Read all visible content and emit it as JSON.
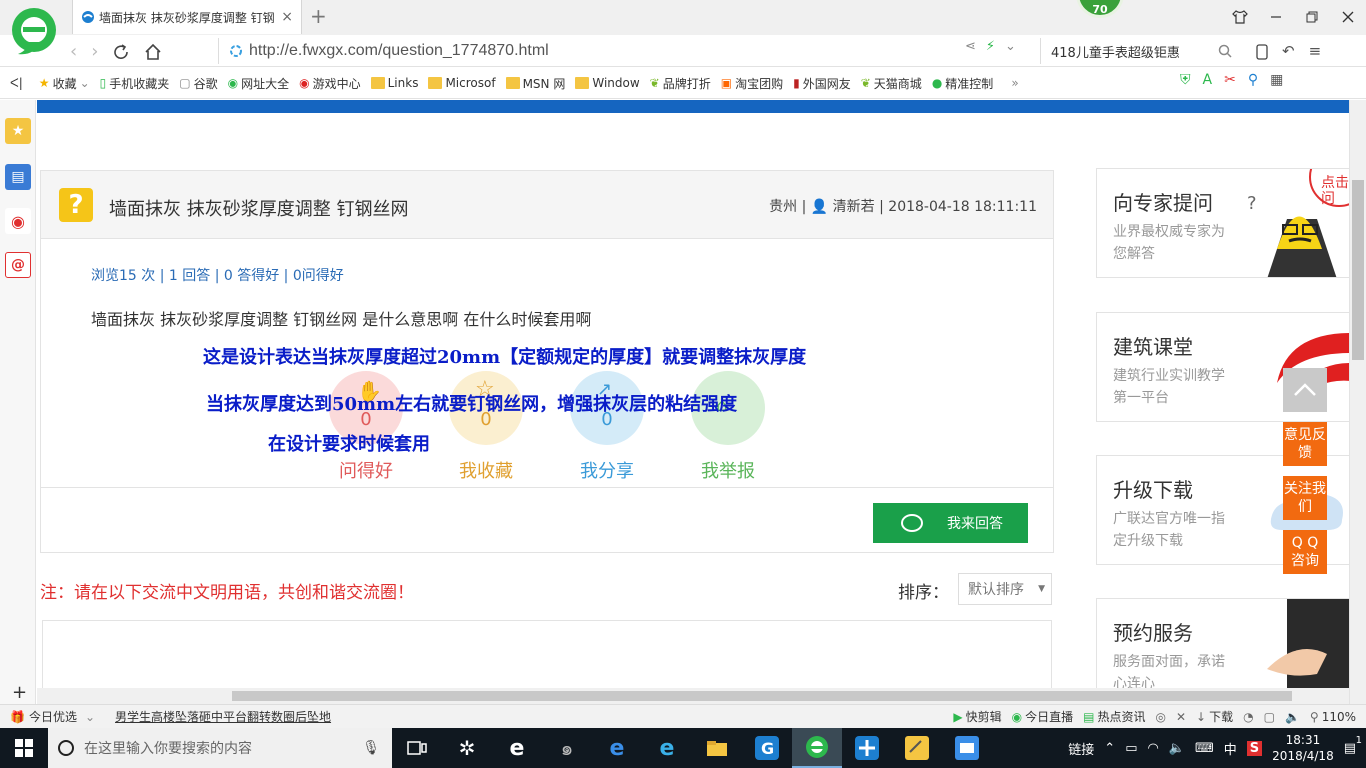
{
  "browser": {
    "tab_title": "墙面抹灰 抹灰砂浆厚度调整 钉钢丝网",
    "tab_close": "×",
    "new_tab": "+",
    "badge": "70",
    "url": "http://e.fwxgx.com/question_1774870.html",
    "search_text": "418儿童手表超级钜惠"
  },
  "bookmarks": [
    {
      "label": "收藏",
      "type": "star"
    },
    {
      "label": "手机收藏夹",
      "type": "phone"
    },
    {
      "label": "谷歌",
      "type": "page"
    },
    {
      "label": "网址大全",
      "type": "globe"
    },
    {
      "label": "游戏中心",
      "type": "game"
    },
    {
      "label": "Links",
      "type": "folder"
    },
    {
      "label": "Microsof",
      "type": "folder"
    },
    {
      "label": "MSN 网",
      "type": "folder"
    },
    {
      "label": "Window",
      "type": "folder"
    },
    {
      "label": "品牌打折",
      "type": "leaf"
    },
    {
      "label": "淘宝团购",
      "type": "taobao"
    },
    {
      "label": "外国网友",
      "type": "flag"
    },
    {
      "label": "天猫商城",
      "type": "leaf"
    },
    {
      "label": "精准控制",
      "type": "chat"
    }
  ],
  "bookmarks_more": "»",
  "question": {
    "title": "墙面抹灰 抹灰砂浆厚度调整 钉钢丝网",
    "location": "贵州",
    "author": "清新若",
    "datetime": "2018-04-18 18:11:11",
    "stats": "浏览15 次 | 1 回答 | 0 答得好 | 0问得好",
    "body": "墙面抹灰 抹灰砂浆厚度调整 钉钢丝网  是什么意思啊  在什么时候套用啊",
    "actions": [
      {
        "label": "问得好",
        "count": "0",
        "color": "#e05a5a",
        "bg": "#fbdada"
      },
      {
        "label": "我收藏",
        "count": "0",
        "color": "#e0a030",
        "bg": "#fbefd0"
      },
      {
        "label": "我分享",
        "count": "0",
        "color": "#3a9ad8",
        "bg": "#d4ebf8"
      },
      {
        "label": "我举报",
        "count": "",
        "color": "#5ab55a",
        "bg": "#d8f0d8"
      }
    ],
    "answer_button": "我来回答"
  },
  "overlay_lines": [
    "这是设计表达当抹灰厚度超过20mm【定额规定的厚度】就要调整抹灰厚度",
    "当抹灰厚度达到50mm左右就要钉钢丝网，增强抹灰层的粘结强度",
    "在设计要求时候套用"
  ],
  "notice": "注：请在以下交流中文明用语，共创和谐交流圈！",
  "sort": {
    "label": "排序：",
    "selected": "默认排序"
  },
  "right_cards": [
    {
      "title": "向专家提问",
      "sub": "业界最权威专家为您解答",
      "bubble": "点击提问"
    },
    {
      "title": "建筑课堂",
      "sub": "建筑行业实训教学第一平台"
    },
    {
      "title": "升级下载",
      "sub": "广联达官方唯一指定升级下载"
    },
    {
      "title": "预约服务",
      "sub": "服务面对面，承诺心连心"
    }
  ],
  "float_buttons": [
    "意见反馈",
    "关注我们",
    "Q Q 咨询"
  ],
  "statusbar": {
    "left_items": [
      "今日优选",
      "男学生高楼坠落砸中平台翻转数圈后坠地"
    ],
    "right_items": [
      "快剪辑",
      "今日直播",
      "热点资讯",
      "下载"
    ],
    "zoom": "110%"
  },
  "taskbar": {
    "search_placeholder": "在这里输入你要搜索的内容",
    "tray_link": "链接",
    "ime": "中",
    "time": "18:31",
    "date": "2018/4/18",
    "notifications": "1"
  },
  "colors": {
    "accent_blue": "#1565c0",
    "answer_green": "#1aa04a",
    "float_orange": "#f26a10",
    "overlay_text": "#0a1dc8"
  }
}
